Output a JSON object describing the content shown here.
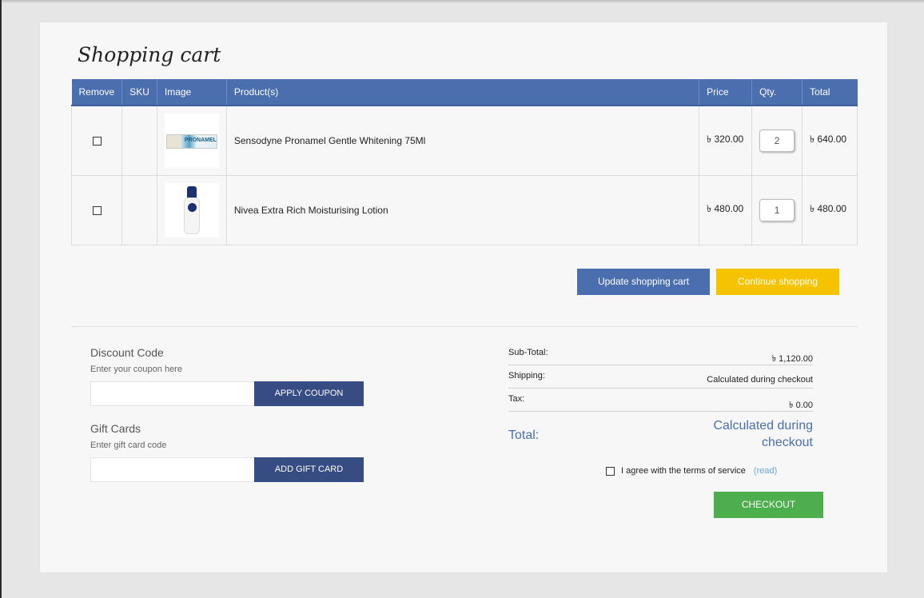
{
  "page": {
    "title": "Shopping cart"
  },
  "table": {
    "headers": [
      "Remove",
      "SKU",
      "Image",
      "Product(s)",
      "Price",
      "Qty.",
      "Total"
    ],
    "rows": [
      {
        "sku": "",
        "product": "Sensodyne Pronamel Gentle Whitening 75Ml",
        "image_text": "PRONAMEL",
        "price": "৳ 320.00",
        "qty": "2",
        "total": "৳ 640.00"
      },
      {
        "sku": "",
        "product": "Nivea Extra Rich Moisturising Lotion",
        "image_text": "",
        "price": "৳ 480.00",
        "qty": "1",
        "total": "৳ 480.00"
      }
    ]
  },
  "actions": {
    "update": "Update shopping cart",
    "continue": "Continue shopping"
  },
  "discount": {
    "title": "Discount Code",
    "hint": "Enter your coupon here",
    "value": "",
    "button": "APPLY COUPON"
  },
  "gift": {
    "title": "Gift Cards",
    "hint": "Enter gift card code",
    "value": "",
    "button": "ADD GIFT CARD"
  },
  "totals": {
    "subtotal_label": "Sub-Total:",
    "subtotal": "৳ 1,120.00",
    "shipping_label": "Shipping:",
    "shipping": "Calculated during checkout",
    "tax_label": "Tax:",
    "tax": "৳ 0.00",
    "total_label": "Total:",
    "total": "Calculated during checkout"
  },
  "terms": {
    "text": "I agree with the terms of service",
    "link": "(read)"
  },
  "checkout": {
    "label": "CHECKOUT"
  },
  "colors": {
    "header": "#4a6eae",
    "update": "#4a6eae",
    "continue": "#f5c300",
    "dark_button": "#364c82",
    "checkout": "#4cae4c"
  }
}
